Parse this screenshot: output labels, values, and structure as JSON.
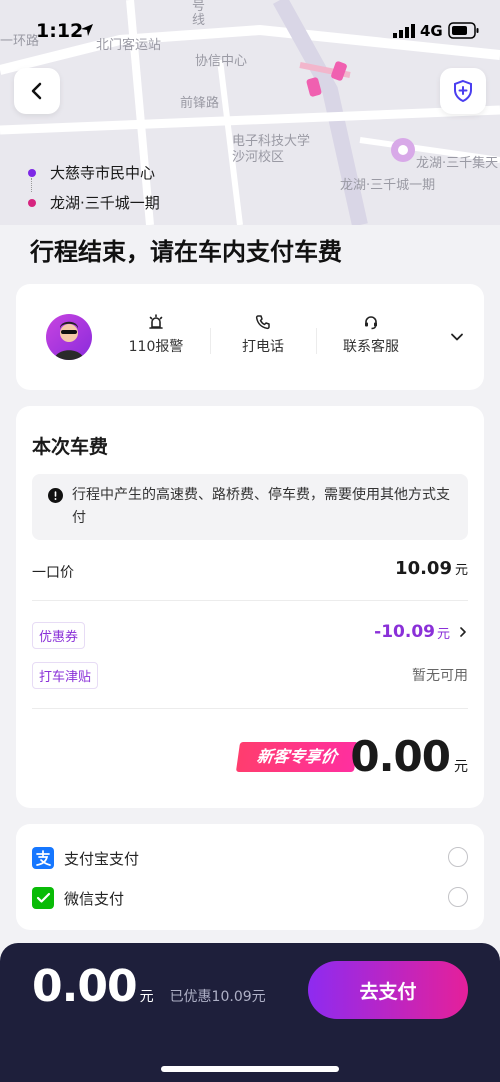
{
  "status": {
    "time": "1:12",
    "network": "4G"
  },
  "map": {
    "labels": [
      "北门客运站",
      "协信中心",
      "前锋路",
      "电子科技大学沙河校区",
      "龙湖·三千城一期",
      "一环路",
      "号线",
      "龙湖·三千集天"
    ]
  },
  "route": {
    "origin": "大慈寺市民中心",
    "destination": "龙湖·三千城一期"
  },
  "headline": "行程结束，请在车内支付车费",
  "actions": {
    "police": "110报警",
    "call": "打电话",
    "service": "联系客服"
  },
  "fare": {
    "title": "本次车费",
    "notice": "行程中产生的高速费、路桥费、停车费，需要使用其他方式支付",
    "fixed_label": "一口价",
    "fixed_value": "10.09",
    "unit": "元",
    "coupon_label": "优惠券",
    "coupon_value": "-10.09",
    "subsidy_label": "打车津贴",
    "subsidy_value": "暂无可用",
    "badge": "新客专享价",
    "total": "0.00"
  },
  "payment": {
    "alipay": "支付宝支付",
    "wechat": "微信支付"
  },
  "bottom": {
    "amount": "0.00",
    "unit": "元",
    "saved": "已优惠10.09元",
    "pay_button": "去支付"
  },
  "colors": {
    "accent": "#8a30d8",
    "pay_gradient_start": "#8e2bf0",
    "pay_gradient_end": "#e5209a",
    "bottom_bg": "#1e1f3b",
    "dest_dot": "#d6247f"
  }
}
